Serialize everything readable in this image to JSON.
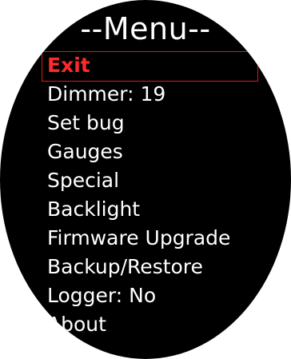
{
  "menu": {
    "title": "--Menu--",
    "selected_color": "#ff2a2a",
    "items": [
      {
        "label": "Exit",
        "selected": true
      },
      {
        "label": "Dimmer: 19",
        "selected": false
      },
      {
        "label": "Set bug",
        "selected": false
      },
      {
        "label": "Gauges",
        "selected": false
      },
      {
        "label": "Special",
        "selected": false
      },
      {
        "label": "Backlight",
        "selected": false
      },
      {
        "label": "Firmware Upgrade",
        "selected": false
      },
      {
        "label": "Backup/Restore",
        "selected": false
      },
      {
        "label": "Logger: No",
        "selected": false
      },
      {
        "label": "About",
        "selected": false
      }
    ]
  }
}
